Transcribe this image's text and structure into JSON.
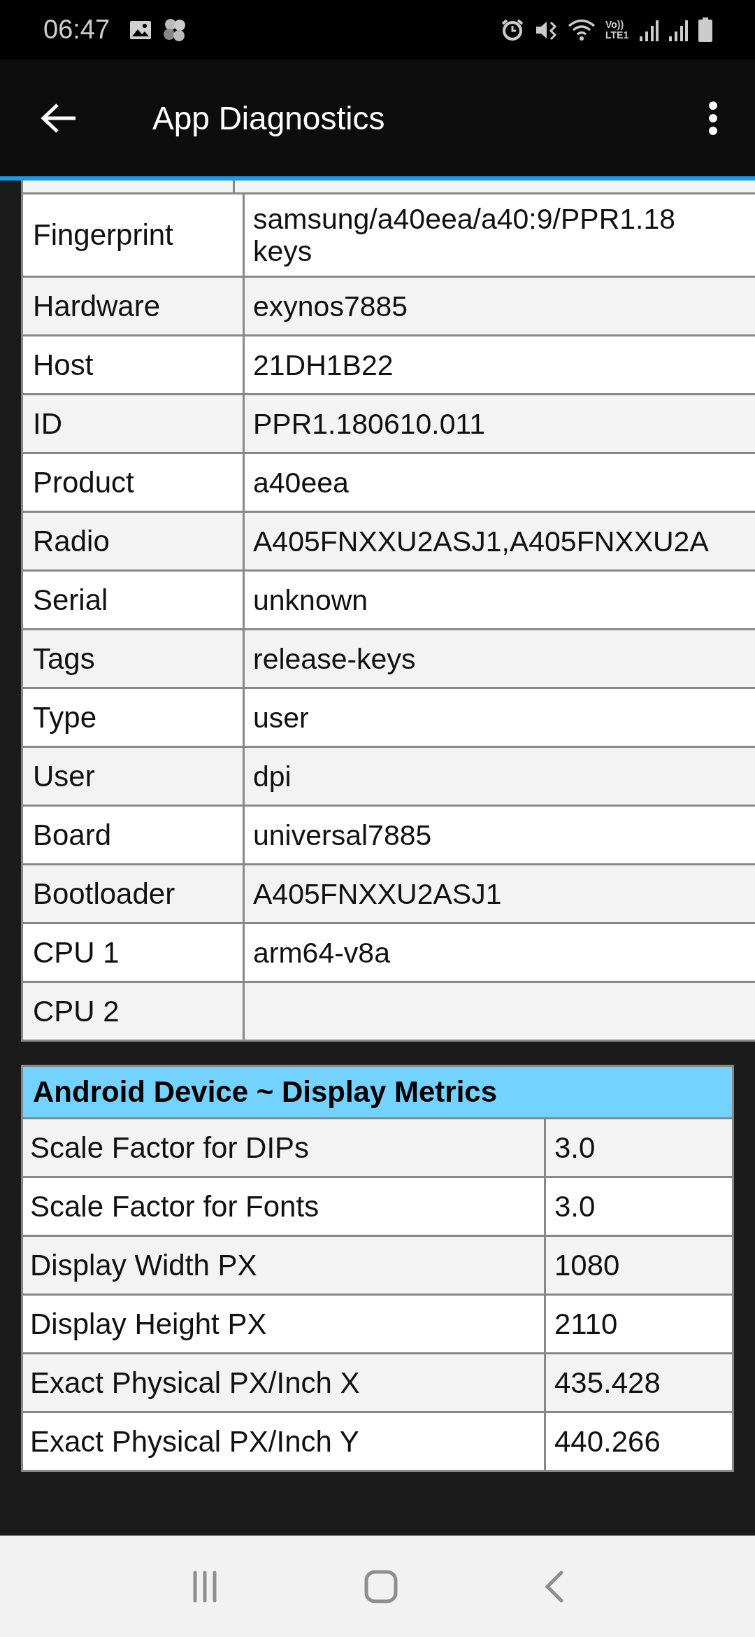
{
  "status_bar": {
    "time": "06:47",
    "network": "Vo)) LTE1"
  },
  "app_bar": {
    "title": "App Diagnostics"
  },
  "build_table": {
    "rows": [
      {
        "label": "Fingerprint",
        "value": "samsung/a40eea/a40:9/PPR1.18\nkeys"
      },
      {
        "label": "Hardware",
        "value": "exynos7885"
      },
      {
        "label": "Host",
        "value": "21DH1B22"
      },
      {
        "label": "ID",
        "value": "PPR1.180610.011"
      },
      {
        "label": "Product",
        "value": "a40eea"
      },
      {
        "label": "Radio",
        "value": "A405FNXXU2ASJ1,A405FNXXU2A"
      },
      {
        "label": "Serial",
        "value": "unknown"
      },
      {
        "label": "Tags",
        "value": "release-keys"
      },
      {
        "label": "Type",
        "value": "user"
      },
      {
        "label": "User",
        "value": "dpi"
      },
      {
        "label": "Board",
        "value": "universal7885"
      },
      {
        "label": "Bootloader",
        "value": "A405FNXXU2ASJ1"
      },
      {
        "label": "CPU 1",
        "value": "arm64-v8a"
      },
      {
        "label": "CPU 2",
        "value": ""
      }
    ]
  },
  "metrics_table": {
    "title": "Android Device ~ Display Metrics",
    "rows": [
      {
        "label": "Scale Factor for DIPs",
        "value": "3.0"
      },
      {
        "label": "Scale Factor for Fonts",
        "value": "3.0"
      },
      {
        "label": "Display Width PX",
        "value": "1080"
      },
      {
        "label": "Display Height PX",
        "value": "2110"
      },
      {
        "label": "Exact Physical PX/Inch X",
        "value": "435.428"
      },
      {
        "label": "Exact Physical PX/Inch Y",
        "value": "440.266"
      }
    ]
  }
}
